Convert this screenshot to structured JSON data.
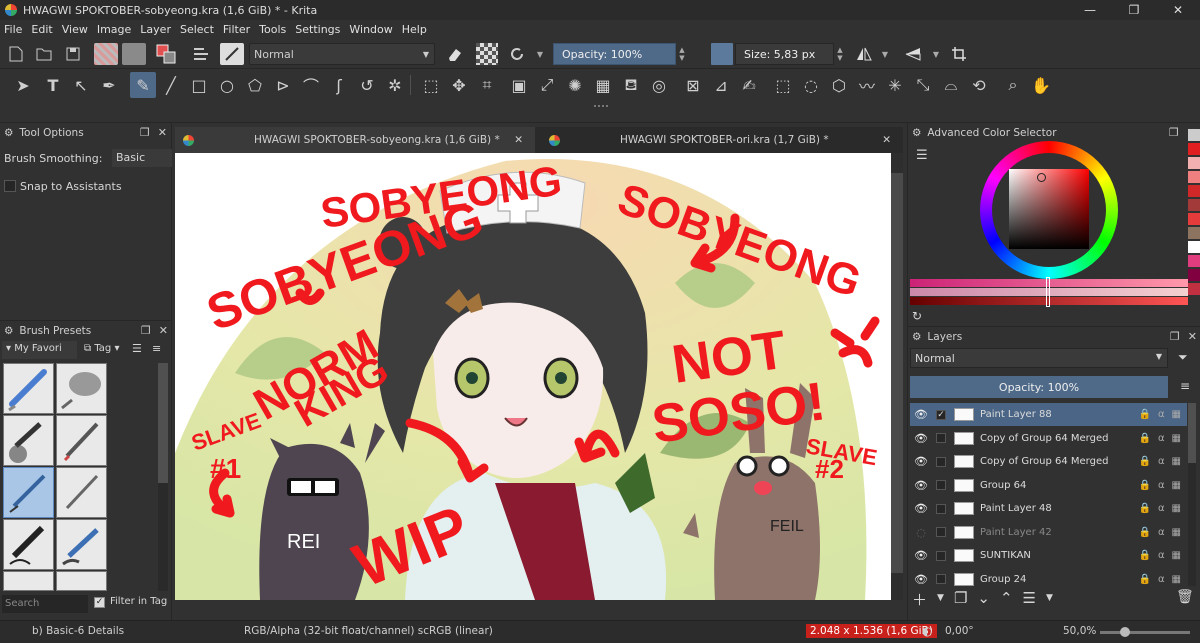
{
  "window": {
    "title": "HWAGWI SPOKTOBER-sobyeong.kra (1,6 GiB) * - Krita",
    "minimize": "—",
    "maximize": "❐",
    "close": "✕"
  },
  "menu": [
    "File",
    "Edit",
    "View",
    "Image",
    "Layer",
    "Select",
    "Filter",
    "Tools",
    "Settings",
    "Window",
    "Help"
  ],
  "toolbar": {
    "blend_mode": "Normal",
    "opacity": "Opacity: 100%",
    "size": "Size: 5,83 px"
  },
  "tool_options": {
    "title": "Tool Options",
    "smoothing_label": "Brush Smoothing:",
    "smoothing_value": "Basic",
    "snap_label": "Snap to Assistants"
  },
  "brush_presets": {
    "title": "Brush Presets",
    "filter": "My Favori",
    "tag": "Tag",
    "search_placeholder": "Search",
    "filter_in_tag": "Filter in Tag"
  },
  "tabs": [
    {
      "label": "HWAGWI SPOKTOBER-sobyeong.kra (1,6 GiB) *",
      "active": true
    },
    {
      "label": "HWAGWI SPOKTOBER-ori.kra (1,7 GiB) *",
      "active": false
    }
  ],
  "canvas_text": {
    "sobyeong_left": "SOBYEONG",
    "sobyeong_top": "SOBYEONG",
    "sobyeong_right": "SOBYEONG",
    "norm": "NORM",
    "king": "KING",
    "slave1": "SLAVE",
    "slave1_num": "#1",
    "not": "NOT",
    "soso": "SOSO!",
    "slave2": "SLAVE",
    "slave2_num": "#2",
    "wip": "WIP",
    "rei": "REI",
    "feil": "FEIL"
  },
  "color_selector": {
    "title": "Advanced Color Selector",
    "swatches": [
      "#e02020",
      "#f3b0b0",
      "#f08080",
      "#d02828",
      "#a23a3a",
      "#e63b3b",
      "#8c7460",
      "#ffffff",
      "#e03d7e",
      "#800040",
      "#c03040"
    ]
  },
  "layers": {
    "title": "Layers",
    "blend": "Normal",
    "opacity": "Opacity:  100%",
    "items": [
      {
        "name": "Paint Layer 88",
        "visible": true,
        "selected": true,
        "checked": true
      },
      {
        "name": "Copy of Group 64 Merged",
        "visible": true,
        "selected": false,
        "checked": false
      },
      {
        "name": "Copy of Group 64 Merged",
        "visible": true,
        "selected": false,
        "checked": false
      },
      {
        "name": "Group 64",
        "visible": true,
        "selected": false,
        "checked": false
      },
      {
        "name": "Paint Layer 48",
        "visible": true,
        "selected": false,
        "checked": false
      },
      {
        "name": "Paint Layer 42",
        "visible": false,
        "selected": false,
        "checked": false
      },
      {
        "name": "SUNTIKAN",
        "visible": true,
        "selected": false,
        "checked": false
      },
      {
        "name": "Group 24",
        "visible": true,
        "selected": false,
        "checked": false
      }
    ]
  },
  "status": {
    "preset": "b) Basic-6 Details",
    "colorspace": "RGB/Alpha (32-bit float/channel)  scRGB (linear)",
    "memory": "2.048 x 1.536 (1,6 GiB)",
    "rotation": "0,00°",
    "zoom": "50,0%"
  },
  "colors": {
    "accent": "#4f6a89",
    "annotation_red": "#f0191d",
    "memory_warning": "#c8201b"
  }
}
